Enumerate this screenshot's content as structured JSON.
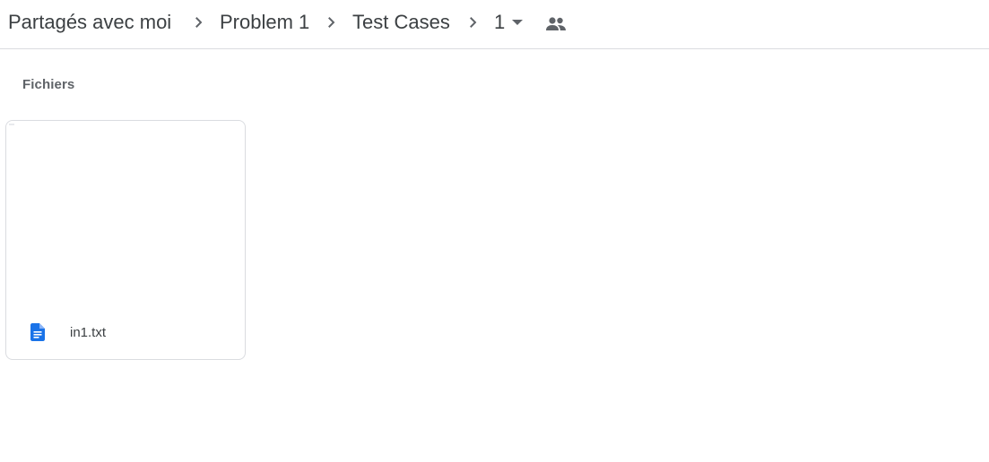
{
  "breadcrumb": {
    "items": [
      {
        "label": "Partagés avec moi"
      },
      {
        "label": "Problem 1"
      },
      {
        "label": "Test Cases"
      },
      {
        "label": "1"
      }
    ]
  },
  "icons": {
    "separator": "chevron-right-icon",
    "dropdown": "arrow-drop-down-icon",
    "shared": "people-icon",
    "file_type": "text-document-icon"
  },
  "section": {
    "title": "Fichiers"
  },
  "files": [
    {
      "name": "in1.txt",
      "type": "txt"
    }
  ],
  "colors": {
    "text": "#3c4043",
    "icon_gray": "#5f6368",
    "doc_blue": "#1a73e8",
    "border": "#dadce0"
  }
}
